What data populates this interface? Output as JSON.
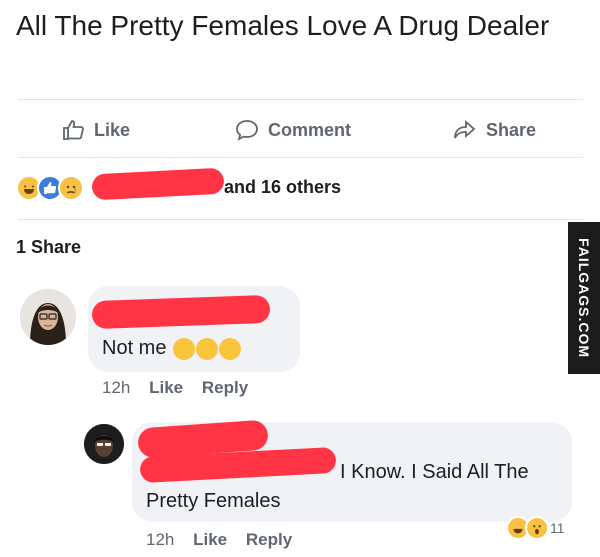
{
  "post": {
    "text": "All The Pretty Females Love A Drug Dealer"
  },
  "actions": {
    "like": "Like",
    "comment": "Comment",
    "share": "Share"
  },
  "reactions": {
    "summary": "and 16 others"
  },
  "shares": {
    "label": "1 Share"
  },
  "comments": [
    {
      "text": "Not me",
      "time": "12h",
      "like": "Like",
      "reply": "Reply"
    },
    {
      "text_part1": "I Know. I Said All The",
      "text_part2": "Pretty Females",
      "time": "12h",
      "like": "Like",
      "reply": "Reply",
      "reaction_count": "11"
    }
  ],
  "watermark": "FAILGAGS.COM",
  "colors": {
    "redaction": "#ff3545",
    "bubble": "#f0f2f5",
    "muted": "#606770"
  }
}
